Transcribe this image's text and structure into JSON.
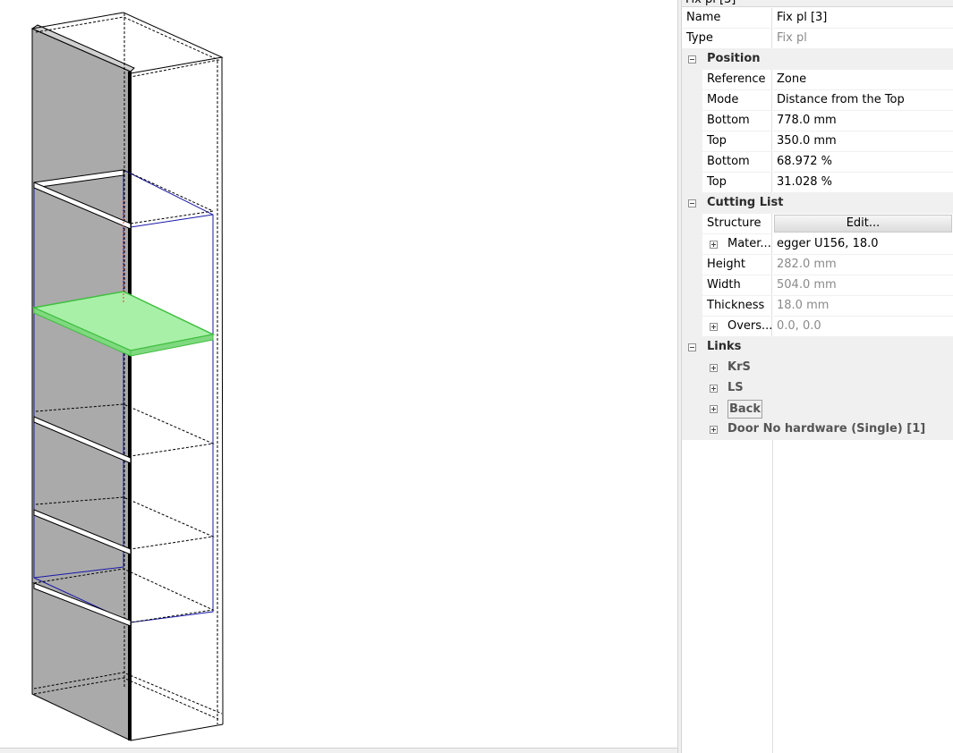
{
  "panel": {
    "title": "Fix pl [3]",
    "rows": {
      "name": {
        "label": "Name",
        "value": "Fix pl [3]"
      },
      "type": {
        "label": "Type",
        "value": "Fix pl"
      }
    },
    "position": {
      "label": "Position",
      "reference": {
        "label": "Reference",
        "value": "Zone"
      },
      "mode": {
        "label": "Mode",
        "value": "Distance from the Top"
      },
      "bottom_mm": {
        "label": "Bottom",
        "value": "778.0 mm"
      },
      "top_mm": {
        "label": "Top",
        "value": "350.0 mm"
      },
      "bottom_pct": {
        "label": "Bottom",
        "value": "68.972 %"
      },
      "top_pct": {
        "label": "Top",
        "value": "31.028 %"
      }
    },
    "cutting_list": {
      "label": "Cutting List",
      "structure": {
        "label": "Structure",
        "button": "Edit..."
      },
      "material": {
        "label": "Mater...",
        "value": "egger U156, 18.0"
      },
      "height": {
        "label": "Height",
        "value": "282.0 mm"
      },
      "width": {
        "label": "Width",
        "value": "504.0 mm"
      },
      "thickness": {
        "label": "Thickness",
        "value": "18.0 mm"
      },
      "oversize": {
        "label": "Overs...",
        "value": "0.0, 0.0"
      }
    },
    "links": {
      "label": "Links",
      "items": [
        "KrS",
        "LS",
        "Back",
        "Door No hardware (Single) [1]"
      ]
    }
  },
  "colors": {
    "side_panel": "#aaaaaa",
    "selection_fill": "#a8f0a8",
    "selection_edge": "#3fbf3f",
    "zone_outline": "#1a1aa8",
    "edge": "#000000"
  }
}
